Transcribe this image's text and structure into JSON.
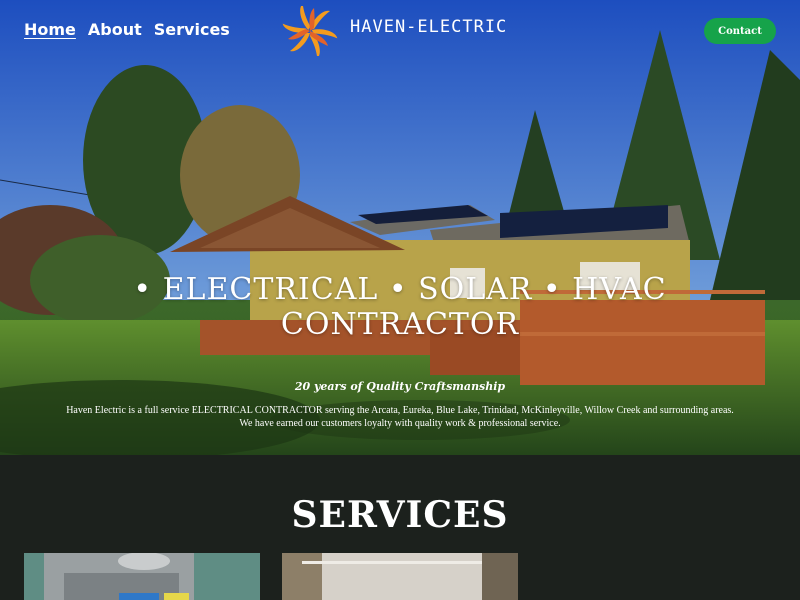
{
  "nav": {
    "items": [
      {
        "label": "Home",
        "active": true
      },
      {
        "label": "About",
        "active": false
      },
      {
        "label": "Services",
        "active": false
      }
    ]
  },
  "brand": {
    "name": "HAVEN-ELECTRIC",
    "logo_icon": "pinwheel-sun-icon"
  },
  "header": {
    "contact_label": "Contact"
  },
  "hero": {
    "headline_line1": "• ELECTRICAL • SOLAR • HVAC",
    "headline_line2": "CONTRACTOR",
    "tagline": "20 years of Quality Craftsmanship",
    "description_line1": "Haven Electric is a full service ELECTRICAL CONTRACTOR serving the Arcata, Eureka, Blue Lake, Trinidad, McKinleyville, Willow Creek and surrounding areas.",
    "description_line2": "We have earned our customers loyalty with quality work & professional service."
  },
  "services": {
    "title": "SERVICES"
  },
  "colors": {
    "accent_green": "#16a34a",
    "logo_orange": "#f39c1f",
    "dark_background": "#1c211d"
  }
}
